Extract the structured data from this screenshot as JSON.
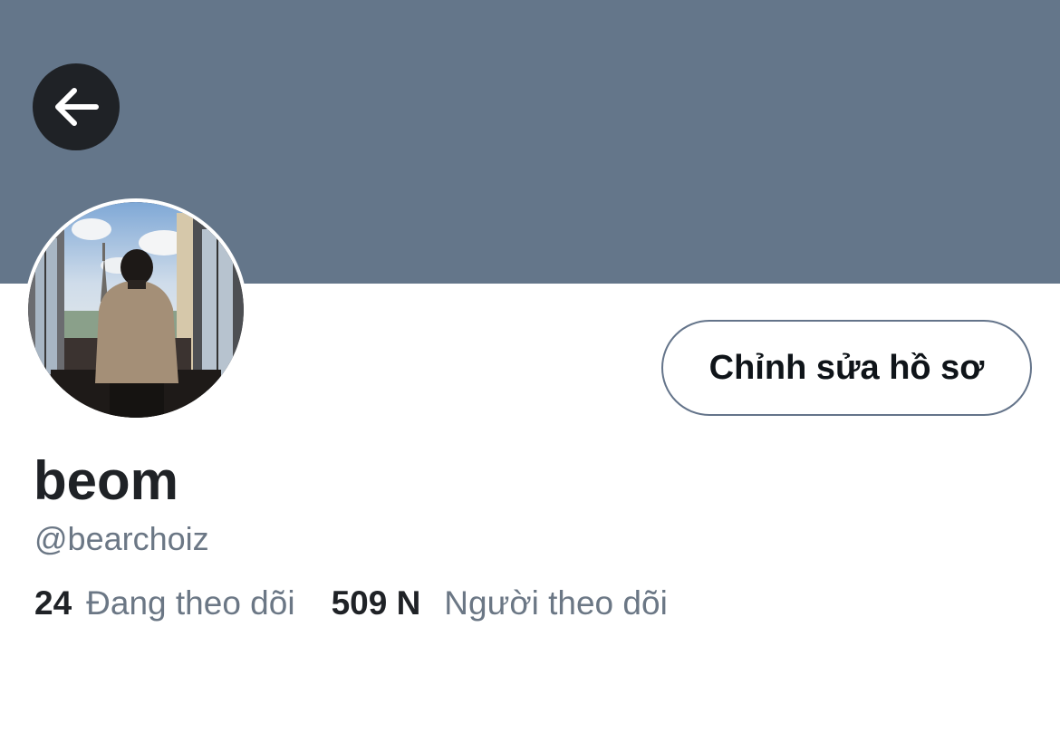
{
  "colors": {
    "banner": "#64768a",
    "back_button_bg": "#1f2226",
    "button_border": "#64748a",
    "text_primary": "#1f2226",
    "text_secondary": "#6b7785"
  },
  "header": {
    "back_icon": "arrow-left-icon"
  },
  "profile": {
    "avatar_icon": "profile-photo",
    "display_name": "beom",
    "handle": "@bearchoiz",
    "edit_button_label": "Chỉnh sửa hồ sơ"
  },
  "stats": {
    "following_count": "24",
    "following_label": "Đang theo dõi",
    "followers_count": "509 N",
    "followers_label": "Người theo dõi"
  }
}
